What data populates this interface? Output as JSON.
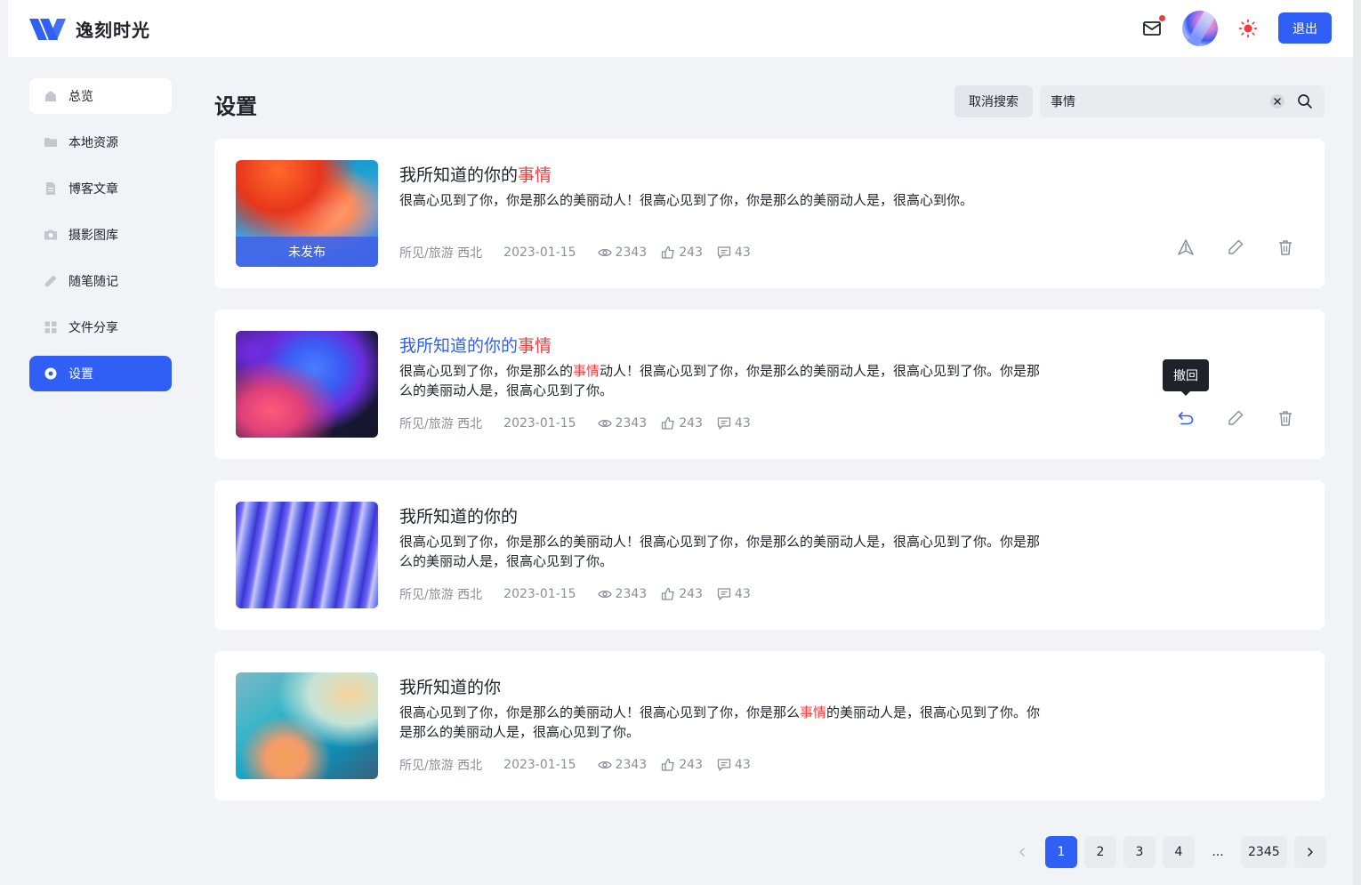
{
  "header": {
    "brand": "逸刻时光",
    "logout_label": "退出",
    "accent_color": "#2f5ff5",
    "notification_dot_color": "#f23c3c"
  },
  "sidebar": {
    "items": [
      {
        "label": "总览",
        "icon": "home-icon"
      },
      {
        "label": "本地资源",
        "icon": "folder-icon"
      },
      {
        "label": "博客文章",
        "icon": "document-icon"
      },
      {
        "label": "摄影图库",
        "icon": "camera-icon"
      },
      {
        "label": "随笔随记",
        "icon": "pencil-icon"
      },
      {
        "label": "文件分享",
        "icon": "grid-icon"
      },
      {
        "label": "设置",
        "icon": "settings-icon",
        "active": true
      }
    ]
  },
  "main": {
    "title": "设置",
    "cancel_search_label": "取消搜索",
    "search_value": "事情"
  },
  "articles": [
    {
      "title_pre": "我所知道的你的",
      "title_hl": "事情",
      "desc_pre": "很高心见到了你，你是那么的美丽动人！很高心见到了你，你是那么的美丽动人是，很高心到你。",
      "desc_hl": "",
      "desc_post": "",
      "badge": "未发布",
      "category": "所见/旅游 西北",
      "date": "2023-01-15",
      "views": "2343",
      "likes": "243",
      "comments": "43"
    },
    {
      "title_pre": "我所知道的你的",
      "title_hl": "事情",
      "desc_pre": "很高心见到了你，你是那么的",
      "desc_hl": "事情",
      "desc_post": "动人！很高心见到了你，你是那么的美丽动人是，很高心见到了你。你是那么的美丽动人是，很高心见到了你。",
      "category": "所见/旅游 西北",
      "date": "2023-01-15",
      "views": "2343",
      "likes": "243",
      "comments": "43",
      "tooltip": "撤回"
    },
    {
      "title_pre": "我所知道的你的",
      "title_hl": "",
      "desc_pre": "很高心见到了你，你是那么的美丽动人！很高心见到了你，你是那么的美丽动人是，很高心见到了你。你是那么的美丽动人是，很高心见到了你。",
      "desc_hl": "",
      "desc_post": "",
      "category": "所见/旅游 西北",
      "date": "2023-01-15",
      "views": "2343",
      "likes": "243",
      "comments": "43"
    },
    {
      "title_pre": "我所知道的你",
      "title_hl": "",
      "desc_pre": "很高心见到了你，你是那么的美丽动人！很高心见到了你，你是那么",
      "desc_hl": "事情",
      "desc_post": "的美丽动人是，很高心见到了你。你是那么的美丽动人是，很高心见到了你。",
      "category": "所见/旅游 西北",
      "date": "2023-01-15",
      "views": "2343",
      "likes": "243",
      "comments": "43"
    }
  ],
  "pagination": {
    "pages": [
      "1",
      "2",
      "3",
      "4",
      "...",
      "2345"
    ],
    "current": "1"
  }
}
